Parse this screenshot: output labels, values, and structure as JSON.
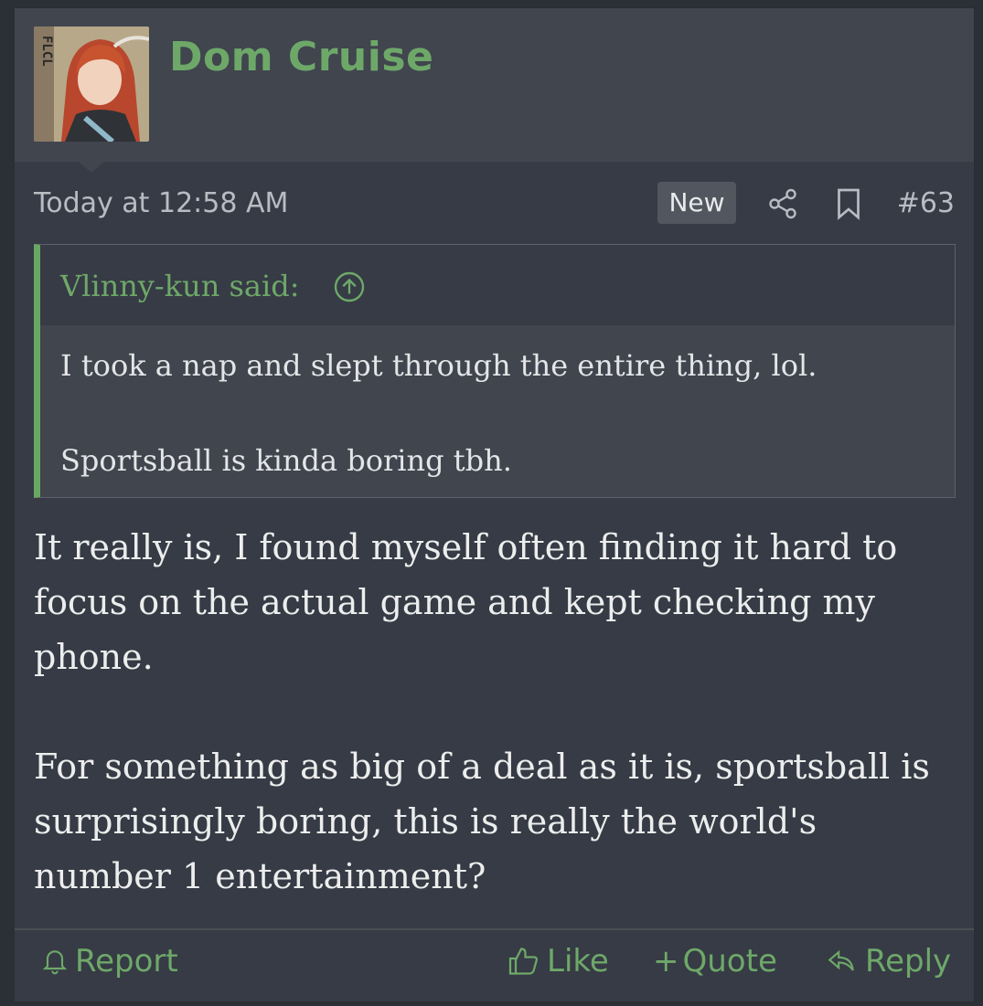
{
  "post": {
    "username": "Dom Cruise",
    "avatar_icon": "avatar-anime-girl",
    "timestamp": "Today at 12:58 AM",
    "badge": "New",
    "post_number": "#63",
    "share_icon": "share-icon",
    "bookmark_icon": "bookmark-icon"
  },
  "quote": {
    "author": "Vlinny-kun said:",
    "lines": [
      "I took a nap and slept through the entire thing, lol.",
      "Sportsball is kinda boring tbh."
    ]
  },
  "message": {
    "paragraphs": [
      "It really is, I found myself often finding it hard to focus on the actual game and kept checking my phone.",
      "For something as big of a deal as it is, sportsball is surprisingly boring, this is really the world's number 1 entertainment?"
    ]
  },
  "actions": {
    "report": "Report",
    "like": "Like",
    "quote": "Quote",
    "reply": "Reply"
  },
  "colors": {
    "accent": "#6ea869",
    "background": "#363b45",
    "header": "#40454e"
  }
}
